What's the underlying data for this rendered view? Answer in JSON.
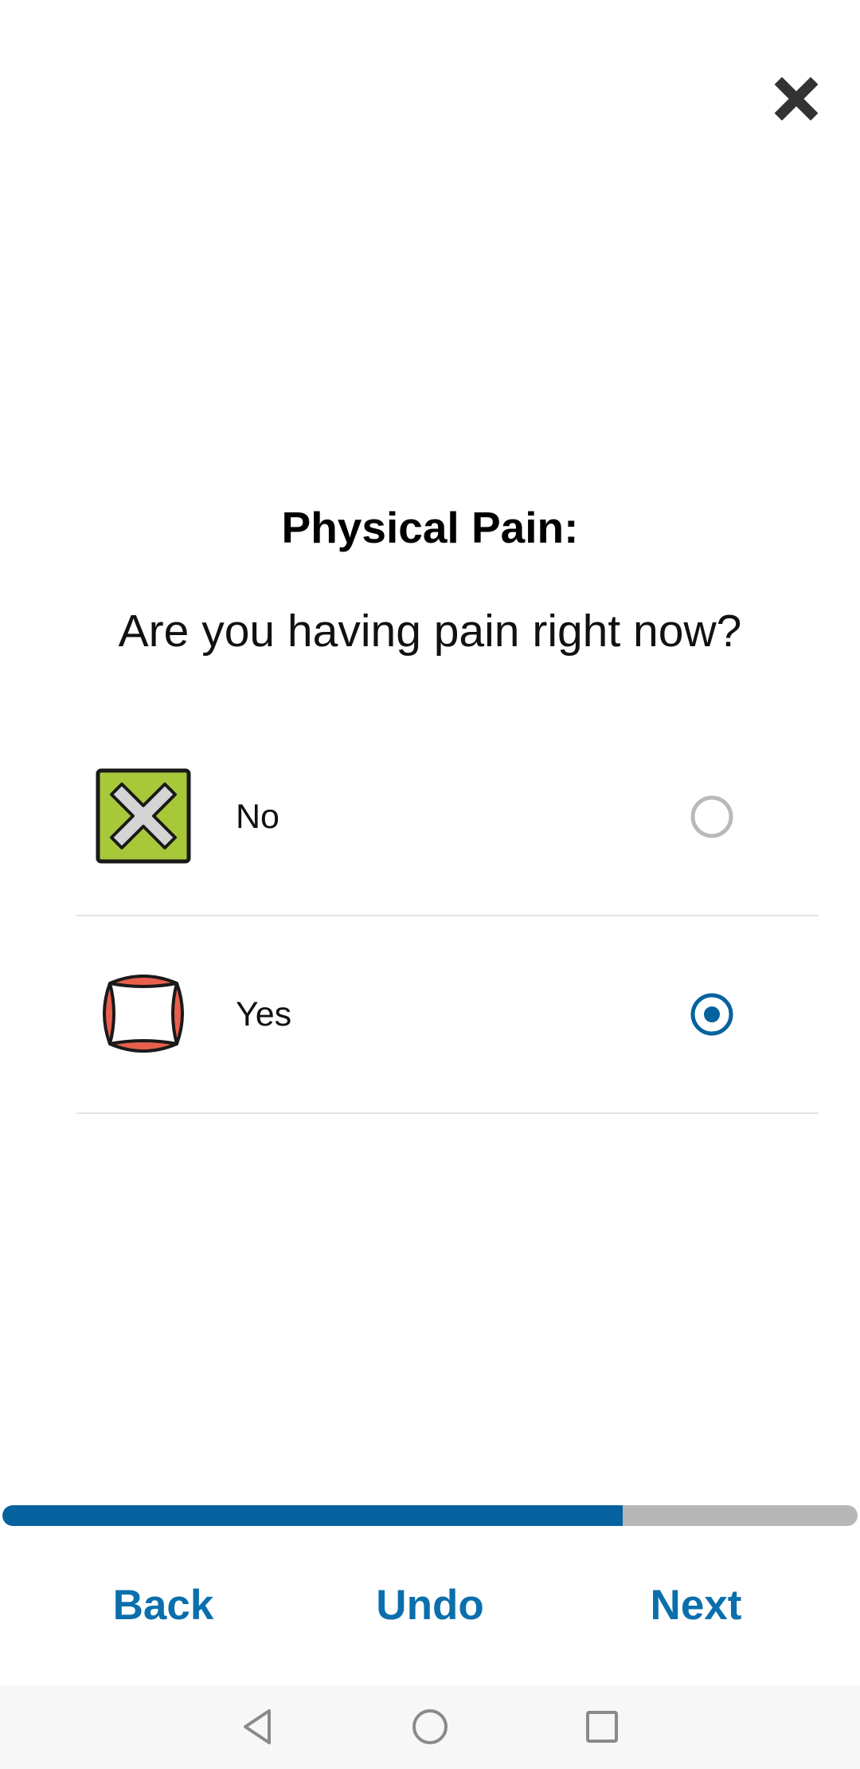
{
  "header": {
    "close_icon": "close-icon"
  },
  "survey": {
    "title": "Physical Pain:",
    "question": "Are you having pain right now?",
    "options": [
      {
        "label": "No",
        "icon": "cross-mark-icon",
        "selected": false
      },
      {
        "label": "Yes",
        "icon": "anger-symbol-icon",
        "selected": true
      }
    ]
  },
  "progress": {
    "fraction": 0.725,
    "fill_color": "#05629f",
    "track_color": "#b6b6b6"
  },
  "navigation": {
    "back_label": "Back",
    "undo_label": "Undo",
    "next_label": "Next",
    "accent_color": "#0a6fac"
  },
  "system_nav": {
    "back_icon": "system-back-icon",
    "home_icon": "system-home-icon",
    "recents_icon": "system-recents-icon"
  }
}
